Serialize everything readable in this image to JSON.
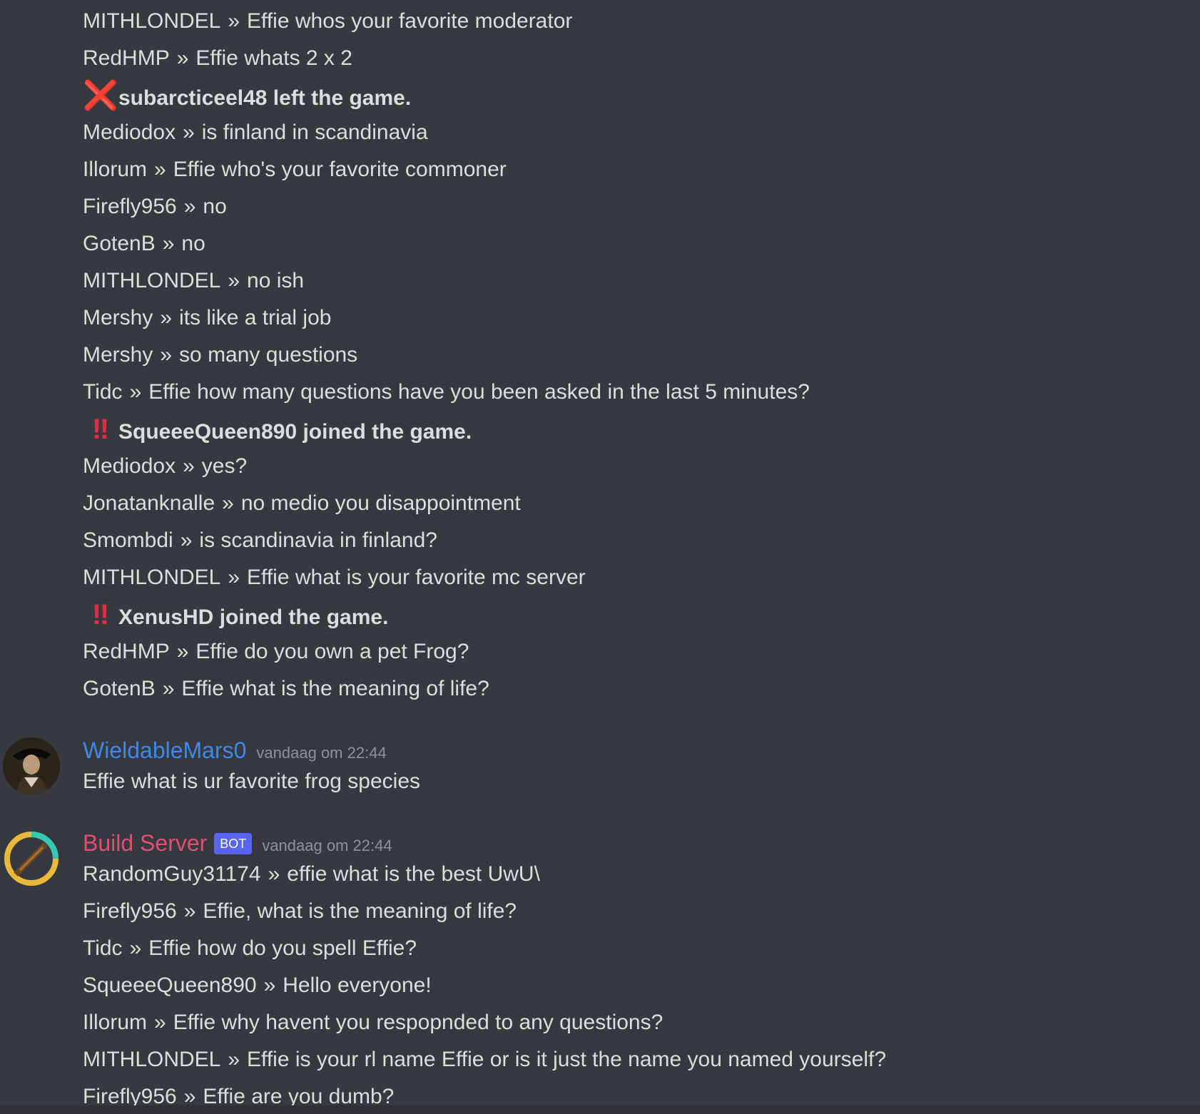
{
  "separator": "»",
  "chat": {
    "lines_top": [
      {
        "user": "MITHLONDEL",
        "text": "Effie whos your favorite moderator"
      },
      {
        "user": "RedHMP",
        "text": "Effie whats 2 x 2"
      },
      {
        "event": "subarcticeel48 left the game.",
        "icon": "❌"
      },
      {
        "user": "Mediodox",
        "text": "is finland in scandinavia"
      },
      {
        "user": "Illorum",
        "text": "Effie who's your favorite commoner"
      },
      {
        "user": "Firefly956",
        "text": "no"
      },
      {
        "user": "GotenB",
        "text": "no"
      },
      {
        "user": "MITHLONDEL",
        "text": "no ish"
      },
      {
        "user": "Mershy",
        "text": "its like a trial job"
      },
      {
        "user": "Mershy",
        "text": "so many questions"
      },
      {
        "user": "Tidc",
        "text": "Effie how many questions have you been asked in the last 5 minutes?"
      },
      {
        "event": "SqueeeQueen890 joined the game.",
        "icon": "‼"
      },
      {
        "user": "Mediodox",
        "text": "yes?"
      },
      {
        "user": "Jonatanknalle",
        "text": "no medio you disappointment"
      },
      {
        "user": "Smombdi",
        "text": "is scandinavia in finland?"
      },
      {
        "user": "MITHLONDEL",
        "text": "Effie what is your favorite mc server"
      },
      {
        "event": "XenusHD joined the game.",
        "icon": "‼"
      },
      {
        "user": "RedHMP",
        "text": "Effie do you own a pet Frog?"
      },
      {
        "user": "GotenB",
        "text": "Effie what is the meaning of life?"
      }
    ],
    "message1": {
      "author": "WieldableMars0",
      "timestamp": "vandaag om 22:44",
      "text": "Effie what is ur favorite frog species",
      "author_color": "#3f87e8"
    },
    "message2": {
      "author": "Build Server",
      "badge": "BOT",
      "timestamp": "vandaag om 22:44",
      "author_color": "#e24e73",
      "lines": [
        {
          "user": "RandomGuy31174",
          "text": "effie what is the best UwU\\"
        },
        {
          "user": "Firefly956",
          "text": "Effie, what is the meaning of life?"
        },
        {
          "user": "Tidc",
          "text": "Effie how do you spell Effie?"
        },
        {
          "user": "SqueeeQueen890",
          "text": "Hello everyone!"
        },
        {
          "user": "Illorum",
          "text": "Effie why havent you respopnded to any questions?"
        },
        {
          "user": "MITHLONDEL",
          "text": "Effie is your rl name Effie or is it just the name you named yourself?"
        },
        {
          "user": "Firefly956",
          "text": "Effie are you dumb?"
        }
      ]
    }
  },
  "colors": {
    "background": "#36393f",
    "text": "#dcddde",
    "timestamp": "#8e9297",
    "bot_badge": "#5865f2"
  }
}
